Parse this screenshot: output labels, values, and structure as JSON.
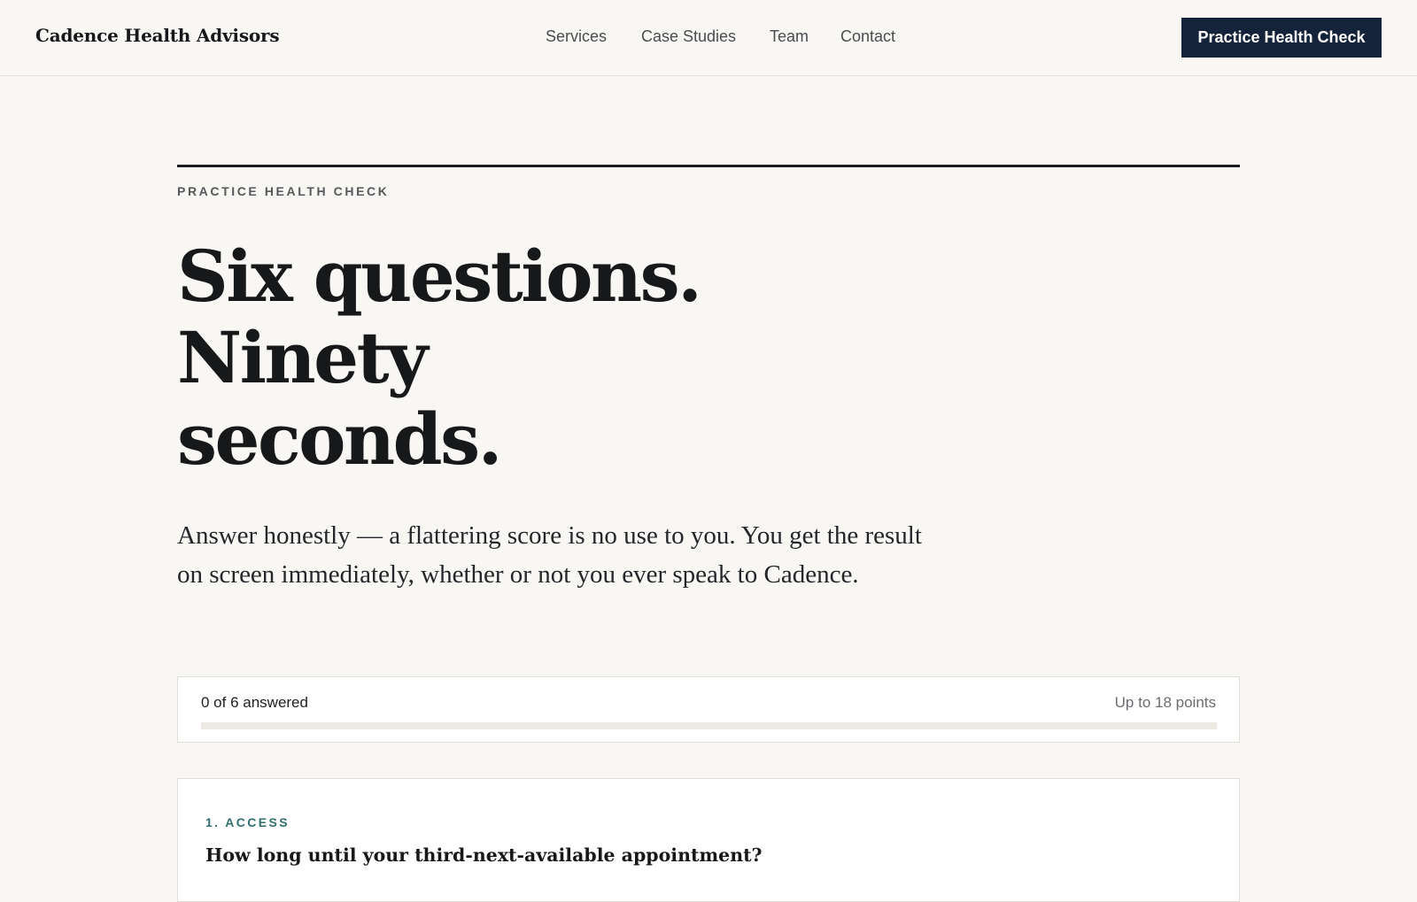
{
  "header": {
    "brand": "Cadence Health Advisors",
    "nav": [
      "Services",
      "Case Studies",
      "Team",
      "Contact"
    ],
    "cta_label": "Practice Health Check"
  },
  "hero": {
    "eyebrow": "PRACTICE HEALTH CHECK",
    "headline_lines": [
      "Six questions.",
      "Ninety",
      "seconds."
    ],
    "lede": "Answer honestly — a flattering score is no use to you. You get the result on screen immediately, whether or not you ever speak to Cadence."
  },
  "progress": {
    "status": "0 of 6 answered",
    "max_points": "Up to 18 points",
    "answered": 0,
    "total": 6
  },
  "questions": [
    {
      "tag": "1. ACCESS",
      "text": "How long until your third-next-available appointment?"
    }
  ],
  "colors": {
    "background": "#f8f7f4",
    "cta": "#15233a",
    "accent_teal": "#2f6f6f"
  }
}
